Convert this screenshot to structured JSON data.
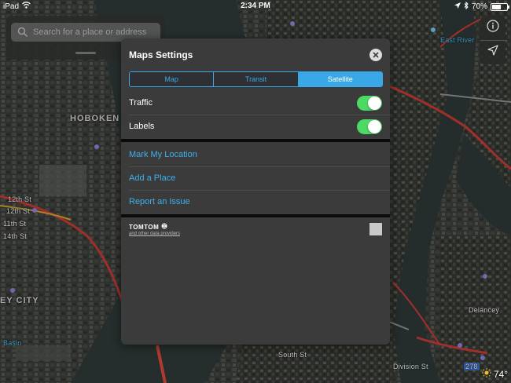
{
  "status_bar": {
    "device": "iPad",
    "time": "2:34 PM",
    "battery": "70%",
    "battery_level": 0.7
  },
  "search": {
    "placeholder": "Search for a place or address"
  },
  "map": {
    "labels": {
      "hoboken": "HOBOKEN",
      "jersey_city": "EY CITY",
      "east_river": "East River",
      "street_12th": "12th St",
      "street_11th": "11th St",
      "street_14th": "14th St",
      "street_south": "South St",
      "street_division": "Division St",
      "street_delancey": "Delancey",
      "basin": "Basin",
      "highway_278": "278",
      "street_12th_alt": "12th St"
    }
  },
  "weather": {
    "temperature": "74°"
  },
  "settings": {
    "title": "Maps Settings",
    "map_types": [
      {
        "label": "Map",
        "active": false
      },
      {
        "label": "Transit",
        "active": false
      },
      {
        "label": "Satellite",
        "active": true
      }
    ],
    "toggles": [
      {
        "label": "Traffic",
        "on": true
      },
      {
        "label": "Labels",
        "on": true
      }
    ],
    "links": [
      {
        "label": "Mark My Location"
      },
      {
        "label": "Add a Place"
      },
      {
        "label": "Report an Issue"
      }
    ],
    "attribution": {
      "brand": "TOMTOM",
      "sub": "and other data providers"
    }
  },
  "colors": {
    "accent": "#3aa7e6",
    "toggle_on": "#4cd964",
    "sheet_bg": "#3b3b3b"
  },
  "icons": [
    "wifi-icon",
    "location-arrow-icon",
    "bluetooth-icon",
    "search-icon",
    "info-icon",
    "tracking-icon",
    "close-icon",
    "sun-icon",
    "tomtom-globe-icon"
  ]
}
